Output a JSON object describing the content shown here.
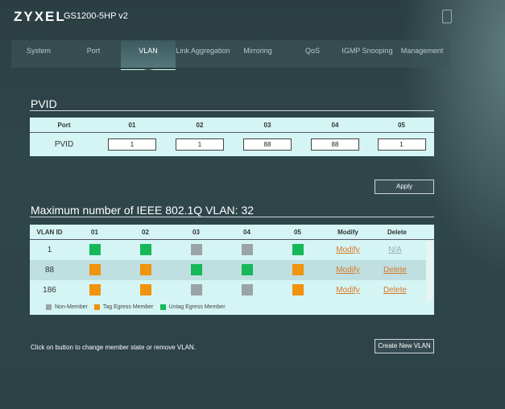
{
  "header": {
    "brand": "ZYXEL",
    "model": "GS1200-5HP v2"
  },
  "nav": [
    "System",
    "Port",
    "VLAN",
    "Link Aggregation",
    "Mirroring",
    "QoS",
    "IGMP Snooping",
    "Management"
  ],
  "active_tab": "VLAN",
  "pvid": {
    "title": "PVID",
    "header": [
      "Port",
      "01",
      "02",
      "03",
      "04",
      "05"
    ],
    "row_label": "PVID",
    "values": [
      "1",
      "1",
      "88",
      "88",
      "1"
    ],
    "apply": "Apply"
  },
  "vlan": {
    "title": "Maximum number of IEEE 802.1Q VLAN: 32",
    "header": [
      "VLAN ID",
      "01",
      "02",
      "03",
      "04",
      "05",
      "Modify",
      "Delete"
    ],
    "rows": [
      {
        "id": "1",
        "ports": [
          "untag",
          "untag",
          "non",
          "non",
          "untag"
        ],
        "modify": "Modify",
        "delete": "N/A"
      },
      {
        "id": "88",
        "ports": [
          "tag",
          "tag",
          "untag",
          "untag",
          "tag"
        ],
        "modify": "Modify",
        "delete": "Delete"
      },
      {
        "id": "186",
        "ports": [
          "tag",
          "tag",
          "non",
          "non",
          "tag"
        ],
        "modify": "Modify",
        "delete": "Delete"
      }
    ],
    "legend": [
      {
        "key": "non",
        "label": "Non-Member"
      },
      {
        "key": "tag",
        "label": "Tag Egress Member"
      },
      {
        "key": "untag",
        "label": "Untag Egress Member"
      }
    ],
    "colors": {
      "non": "#9aa3a6",
      "tag": "#f0930e",
      "untag": "#16b857"
    }
  },
  "footer": {
    "hint": "Click on button to change member state or remove VLAN.",
    "create": "Create New VLAN"
  }
}
